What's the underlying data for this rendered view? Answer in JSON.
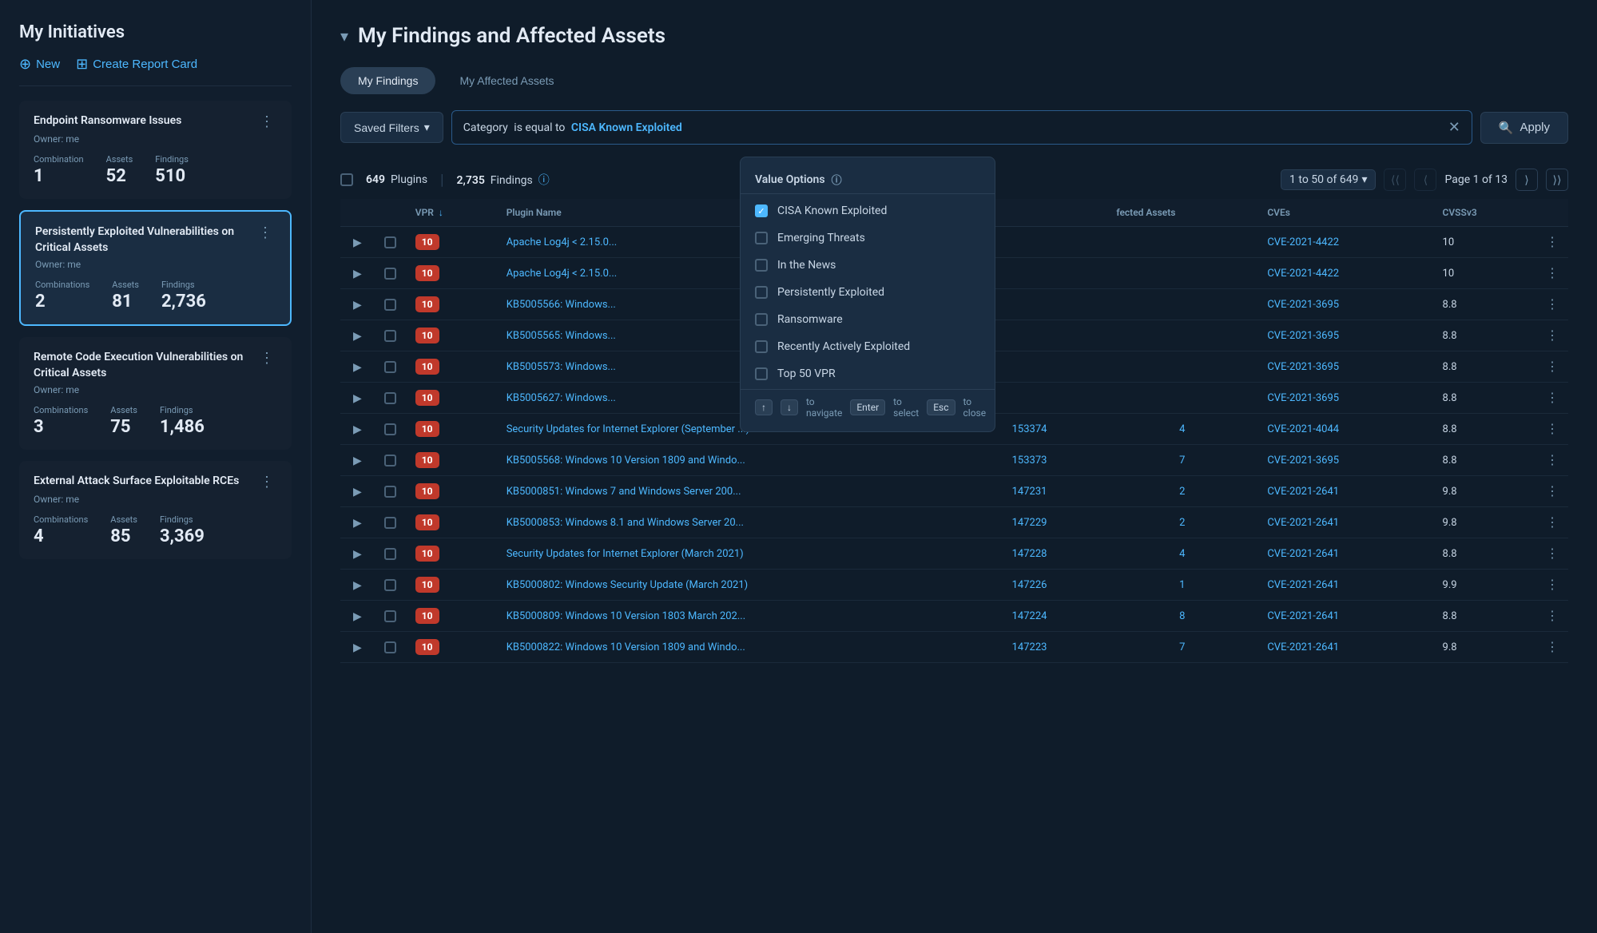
{
  "sidebar": {
    "title": "My Initiatives",
    "new_label": "New",
    "create_report_label": "Create Report Card",
    "initiatives": [
      {
        "id": "init1",
        "title": "Endpoint Ransomware Issues",
        "owner": "Owner: me",
        "active": false,
        "combination_label": "Combination",
        "combination": "1",
        "assets_label": "Assets",
        "assets": "52",
        "findings_label": "Findings",
        "findings": "510"
      },
      {
        "id": "init2",
        "title": "Persistently Exploited Vulnerabilities on Critical Assets",
        "owner": "Owner: me",
        "active": true,
        "combinations_label": "Combinations",
        "combinations": "2",
        "assets_label": "Assets",
        "assets": "81",
        "findings_label": "Findings",
        "findings": "2,736"
      },
      {
        "id": "init3",
        "title": "Remote Code Execution Vulnerabilities on Critical Assets",
        "owner": "Owner: me",
        "active": false,
        "combinations_label": "Combinations",
        "combinations": "3",
        "assets_label": "Assets",
        "assets": "75",
        "findings_label": "Findings",
        "findings": "1,486"
      },
      {
        "id": "init4",
        "title": "External Attack Surface Exploitable RCEs",
        "owner": "Owner: me",
        "active": false,
        "combinations_label": "Combinations",
        "combinations": "4",
        "assets_label": "Assets",
        "assets": "85",
        "findings_label": "Findings",
        "findings": "3,369"
      }
    ]
  },
  "main": {
    "section_title": "My Findings and Affected Assets",
    "tabs": [
      {
        "id": "findings",
        "label": "My Findings",
        "active": true
      },
      {
        "id": "assets",
        "label": "My Affected Assets",
        "active": false
      }
    ],
    "filter": {
      "saved_filters_label": "Saved Filters",
      "filter_key": "Category",
      "filter_op": "is equal to",
      "filter_val": "CISA Known Exploited",
      "apply_label": "Apply"
    },
    "value_options": {
      "header": "Value Options",
      "options": [
        {
          "id": "cisa",
          "label": "CISA Known Exploited",
          "checked": true
        },
        {
          "id": "emerging",
          "label": "Emerging Threats",
          "checked": false
        },
        {
          "id": "news",
          "label": "In the News",
          "checked": false
        },
        {
          "id": "persistent",
          "label": "Persistently Exploited",
          "checked": false
        },
        {
          "id": "ransomware",
          "label": "Ransomware",
          "checked": false
        },
        {
          "id": "recently",
          "label": "Recently Actively Exploited",
          "checked": false
        },
        {
          "id": "top50",
          "label": "Top 50 VPR",
          "checked": false
        }
      ],
      "footer": {
        "up_key": "↑",
        "down_key": "↓",
        "nav_label": "to navigate",
        "enter_key": "Enter",
        "select_label": "to select",
        "esc_key": "Esc",
        "close_label": "to close"
      }
    },
    "table": {
      "plugins_count": "649",
      "plugins_label": "Plugins",
      "findings_count": "2,735",
      "findings_label": "Findings",
      "pagination": {
        "range": "1 to 50 of 649",
        "dropdown_icon": "▾",
        "page_label": "Page 1 of 13"
      },
      "columns": [
        {
          "id": "expand",
          "label": ""
        },
        {
          "id": "cb",
          "label": ""
        },
        {
          "id": "vpr",
          "label": "VPR"
        },
        {
          "id": "plugin_name",
          "label": "Plugin Name"
        },
        {
          "id": "plugin_id",
          "label": ""
        },
        {
          "id": "affected_assets",
          "label": "fected Assets"
        },
        {
          "id": "cves",
          "label": "CVEs"
        },
        {
          "id": "cvssv3",
          "label": "CVSSv3"
        },
        {
          "id": "actions",
          "label": ""
        }
      ],
      "rows": [
        {
          "vpr": "10",
          "plugin_name": "Apache Log4j < 2.15.0...",
          "plugin_id": "",
          "affected_assets": "",
          "cve": "CVE-2021-4422",
          "cvssv3": "10",
          "has_actions": true
        },
        {
          "vpr": "10",
          "plugin_name": "Apache Log4j < 2.15.0...",
          "plugin_id": "",
          "affected_assets": "",
          "cve": "CVE-2021-4422",
          "cvssv3": "10",
          "has_actions": true
        },
        {
          "vpr": "10",
          "plugin_name": "KB5005566: Windows...",
          "plugin_id": "",
          "affected_assets": "",
          "cve": "CVE-2021-3695",
          "cvssv3": "8.8",
          "has_actions": true
        },
        {
          "vpr": "10",
          "plugin_name": "KB5005565: Windows...",
          "plugin_id": "",
          "affected_assets": "",
          "cve": "CVE-2021-3695",
          "cvssv3": "8.8",
          "has_actions": true
        },
        {
          "vpr": "10",
          "plugin_name": "KB5005573: Windows...",
          "plugin_id": "",
          "affected_assets": "",
          "cve": "CVE-2021-3695",
          "cvssv3": "8.8",
          "has_actions": true
        },
        {
          "vpr": "10",
          "plugin_name": "KB5005627: Windows...",
          "plugin_id": "",
          "affected_assets": "",
          "cve": "CVE-2021-3695",
          "cvssv3": "8.8",
          "has_actions": true
        },
        {
          "vpr": "10",
          "plugin_name": "Security Updates for Internet Explorer (September ...)",
          "plugin_id": "153374",
          "affected_assets": "4",
          "cve": "CVE-2021-4044",
          "cvssv3": "8.8",
          "has_actions": true
        },
        {
          "vpr": "10",
          "plugin_name": "KB5005568: Windows 10 Version 1809 and Windo...",
          "plugin_id": "153373",
          "affected_assets": "7",
          "cve": "CVE-2021-3695",
          "cvssv3": "8.8",
          "has_actions": true
        },
        {
          "vpr": "10",
          "plugin_name": "KB5000851: Windows 7 and Windows Server 200...",
          "plugin_id": "147231",
          "affected_assets": "2",
          "cve": "CVE-2021-2641",
          "cvssv3": "9.8",
          "has_actions": true
        },
        {
          "vpr": "10",
          "plugin_name": "KB5000853: Windows 8.1 and Windows Server 20...",
          "plugin_id": "147229",
          "affected_assets": "2",
          "cve": "CVE-2021-2641",
          "cvssv3": "9.8",
          "has_actions": true
        },
        {
          "vpr": "10",
          "plugin_name": "Security Updates for Internet Explorer (March 2021)",
          "plugin_id": "147228",
          "affected_assets": "4",
          "cve": "CVE-2021-2641",
          "cvssv3": "8.8",
          "has_actions": true
        },
        {
          "vpr": "10",
          "plugin_name": "KB5000802: Windows Security Update (March 2021)",
          "plugin_id": "147226",
          "affected_assets": "1",
          "cve": "CVE-2021-2641",
          "cvssv3": "9.9",
          "has_actions": true
        },
        {
          "vpr": "10",
          "plugin_name": "KB5000809: Windows 10 Version 1803 March 202...",
          "plugin_id": "147224",
          "affected_assets": "8",
          "cve": "CVE-2021-2641",
          "cvssv3": "8.8",
          "has_actions": true
        },
        {
          "vpr": "10",
          "plugin_name": "KB5000822: Windows 10 Version 1809 and Windo...",
          "plugin_id": "147223",
          "affected_assets": "7",
          "cve": "CVE-2021-2641",
          "cvssv3": "9.8",
          "has_actions": true
        }
      ]
    }
  }
}
